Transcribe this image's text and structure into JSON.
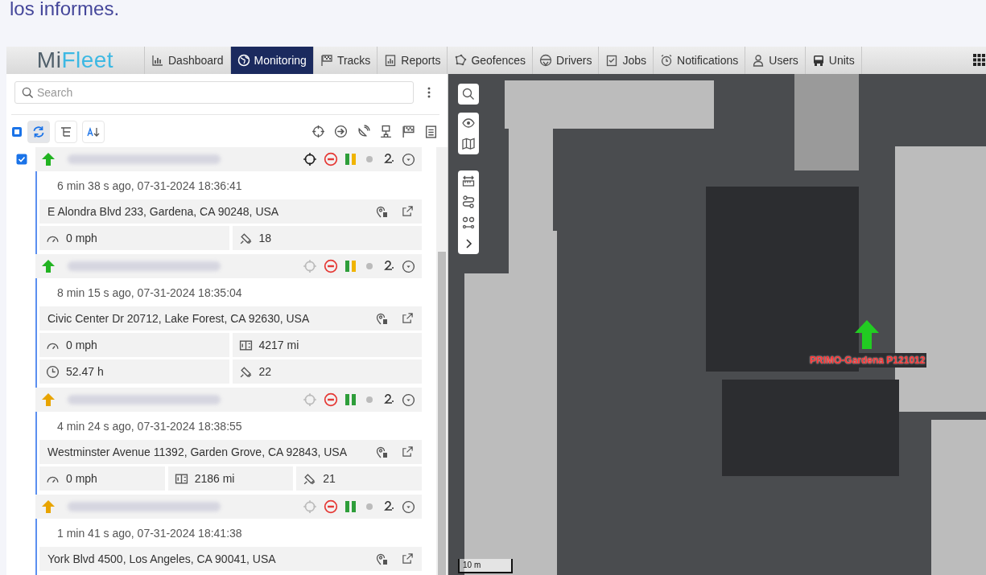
{
  "page_heading": "los informes.",
  "logo_parts": [
    "Mi",
    "Fleet"
  ],
  "tabs": [
    {
      "label": "Dashboard",
      "selected": false
    },
    {
      "label": "Monitoring",
      "selected": true
    },
    {
      "label": "Tracks",
      "selected": false
    },
    {
      "label": "Reports",
      "selected": false
    },
    {
      "label": "Geofences",
      "selected": false
    },
    {
      "label": "Drivers",
      "selected": false
    },
    {
      "label": "Jobs",
      "selected": false
    },
    {
      "label": "Notifications",
      "selected": false
    },
    {
      "label": "Users",
      "selected": false
    },
    {
      "label": "Units",
      "selected": false
    }
  ],
  "search": {
    "placeholder": "Search"
  },
  "toolbar": {
    "select_all_checked": false,
    "auto_refresh_on": true
  },
  "units": [
    {
      "checked": true,
      "color": "#22b322",
      "locate_active": true,
      "bars": [
        {
          "color": "#2e9e3a"
        },
        {
          "color": "#f0b400"
        }
      ],
      "time": "6 min 38 s ago, 07-31-2024 18:36:41",
      "address": "E Alondra Blvd 233, Gardena, CA 90248, USA",
      "stat_rows": [
        [
          {
            "kind": "speed",
            "value": "0 mph"
          },
          {
            "kind": "satellites",
            "value": "18"
          }
        ]
      ]
    },
    {
      "checked": false,
      "color": "#22b322",
      "locate_active": false,
      "bars": [
        {
          "color": "#2e9e3a"
        },
        {
          "color": "#f0b400"
        }
      ],
      "time": "8 min 15 s ago, 07-31-2024 18:35:04",
      "address": "Civic Center Dr 20712, Lake Forest, CA 92630, USA",
      "stat_rows": [
        [
          {
            "kind": "speed",
            "value": "0 mph"
          },
          {
            "kind": "odometer",
            "value": "4217 mi"
          }
        ],
        [
          {
            "kind": "hours",
            "value": "52.47 h"
          },
          {
            "kind": "satellites",
            "value": "22"
          }
        ]
      ]
    },
    {
      "checked": false,
      "color": "#e8a400",
      "locate_active": false,
      "bars": [
        {
          "color": "#2e9e3a"
        },
        {
          "color": "#2e9e3a"
        }
      ],
      "time": "4 min 24 s ago, 07-31-2024 18:38:55",
      "address": "Westminster Avenue 11392, Garden Grove, CA 92843, USA",
      "stat_rows": [
        [
          {
            "kind": "speed",
            "value": "0 mph"
          },
          {
            "kind": "odometer",
            "value": "2186 mi"
          },
          {
            "kind": "satellites",
            "value": "21"
          }
        ]
      ]
    },
    {
      "checked": false,
      "color": "#e8a400",
      "locate_active": false,
      "bars": [
        {
          "color": "#2e9e3a"
        },
        {
          "color": "#2e9e3a"
        }
      ],
      "time": "1 min 41 s ago, 07-31-2024 18:41:38",
      "address": "York Blvd 4500, Los Angeles, CA 90041, USA"
    }
  ],
  "map": {
    "marker_label": "PRIMO-Gardena P121012",
    "scale": "10 m"
  }
}
